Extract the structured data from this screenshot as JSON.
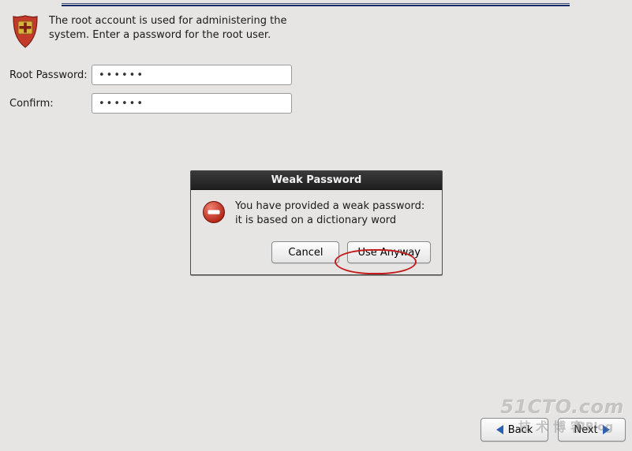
{
  "intro": {
    "text": "The root account is used for administering the system.  Enter a password for the root user."
  },
  "form": {
    "root_label": "Root Password:",
    "confirm_label": "Confirm:",
    "root_value": "••••••",
    "confirm_value": "••••••"
  },
  "dialog": {
    "title": "Weak Password",
    "message": "You have provided a weak password: it is based on a dictionary word",
    "cancel_label": "Cancel",
    "use_anyway_label": "Use Anyway"
  },
  "nav": {
    "back_label": "Back",
    "next_label": "Next"
  },
  "watermark": {
    "line1": "51CTO.com",
    "line2": "技术博客",
    "line3": "NBlog"
  },
  "icons": {
    "shield": "shield-icon",
    "error": "error-icon",
    "arrow_left": "arrow-left-icon",
    "arrow_right": "arrow-right-icon"
  },
  "colors": {
    "shield_red": "#c33a2b",
    "shield_gold": "#d7b23c",
    "error_red1": "#e35b47",
    "error_red2": "#b22514",
    "nav_arrow": "#2c5fb3",
    "highlight": "#c21d1d"
  }
}
